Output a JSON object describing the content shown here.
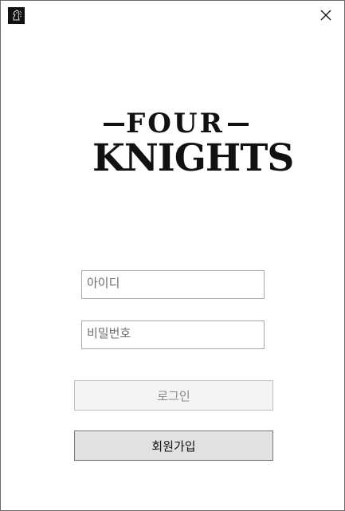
{
  "window": {
    "close_glyph": "×"
  },
  "logo": {
    "line1": "FOUR",
    "line2": "KNIGHTS"
  },
  "login_form": {
    "id_placeholder": "아이디",
    "password_placeholder": "비밀번호",
    "login_label": "로그인",
    "signup_label": "회원가입"
  },
  "colors": {
    "logo": "#111111",
    "field_border": "#a9a9a9",
    "login_button_bg": "#f4f4f4",
    "signup_button_bg": "#e1e1e1"
  }
}
